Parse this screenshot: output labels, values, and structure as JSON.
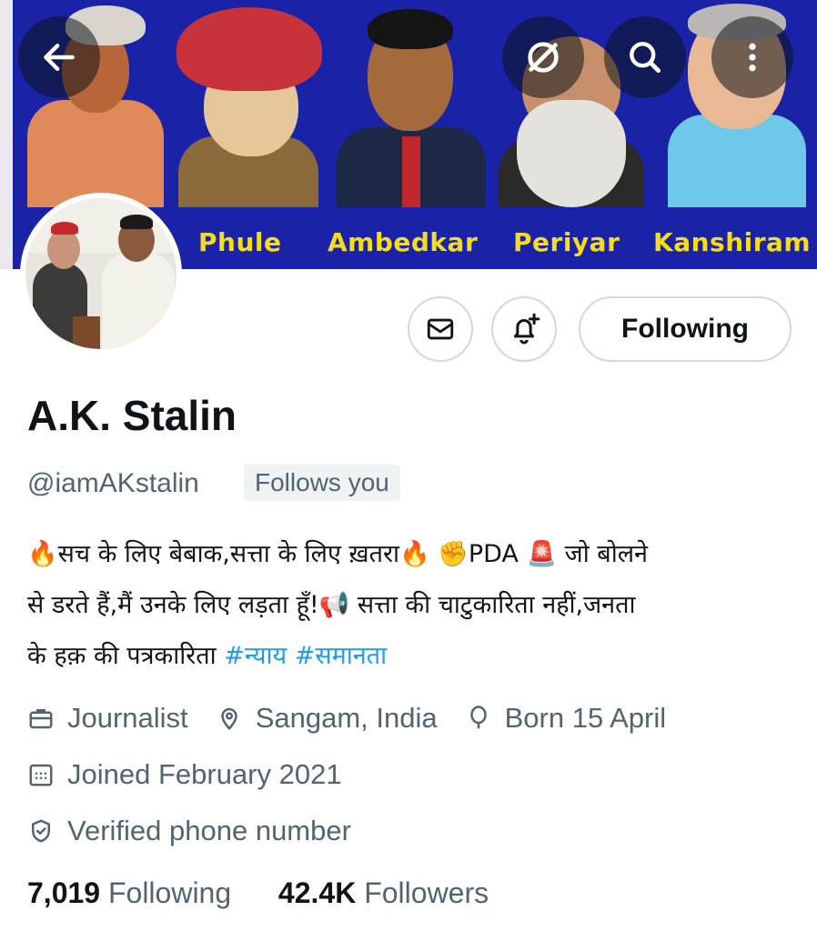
{
  "header": {
    "back_icon": "arrow-left-icon",
    "share_icon": "link-off-icon",
    "search_icon": "search-icon",
    "more_icon": "more-vertical-icon"
  },
  "banner": {
    "background": "#1a23a8",
    "label_color": "#f5dd1a",
    "labels": [
      "Phule",
      "Ambedkar",
      "Periyar",
      "Kanshiram"
    ]
  },
  "actions": {
    "message_icon": "mail-icon",
    "notify_icon": "bell-plus-icon",
    "follow_label": "Following"
  },
  "profile": {
    "display_name": "A.K. Stalin",
    "handle": "@iamAKstalin",
    "follows_you": "Follows you",
    "bio_line1": "🔥सच के लिए बेबाक,सत्ता के लिए ख़तरा🔥 ✊PDA 🚨 जो बोलने",
    "bio_line2": "से डरते हैं,मैं उनके लिए लड़ता हूँ!📢 सत्ता की चाटुकारिता नहीं,जनता",
    "bio_line3_text": "के हक़ की पत्रकारिता ",
    "bio_tag1": "#न्याय",
    "bio_tag2": "#समानता",
    "hashtag_color": "#1d9bf0"
  },
  "meta": {
    "profession": "Journalist",
    "location": "Sangam, India",
    "birthday": "Born 15 April",
    "joined": "Joined February 2021",
    "verified": "Verified phone number"
  },
  "stats": {
    "following_count": "7,019",
    "following_label": "Following",
    "followers_count": "42.4K",
    "followers_label": "Followers"
  }
}
